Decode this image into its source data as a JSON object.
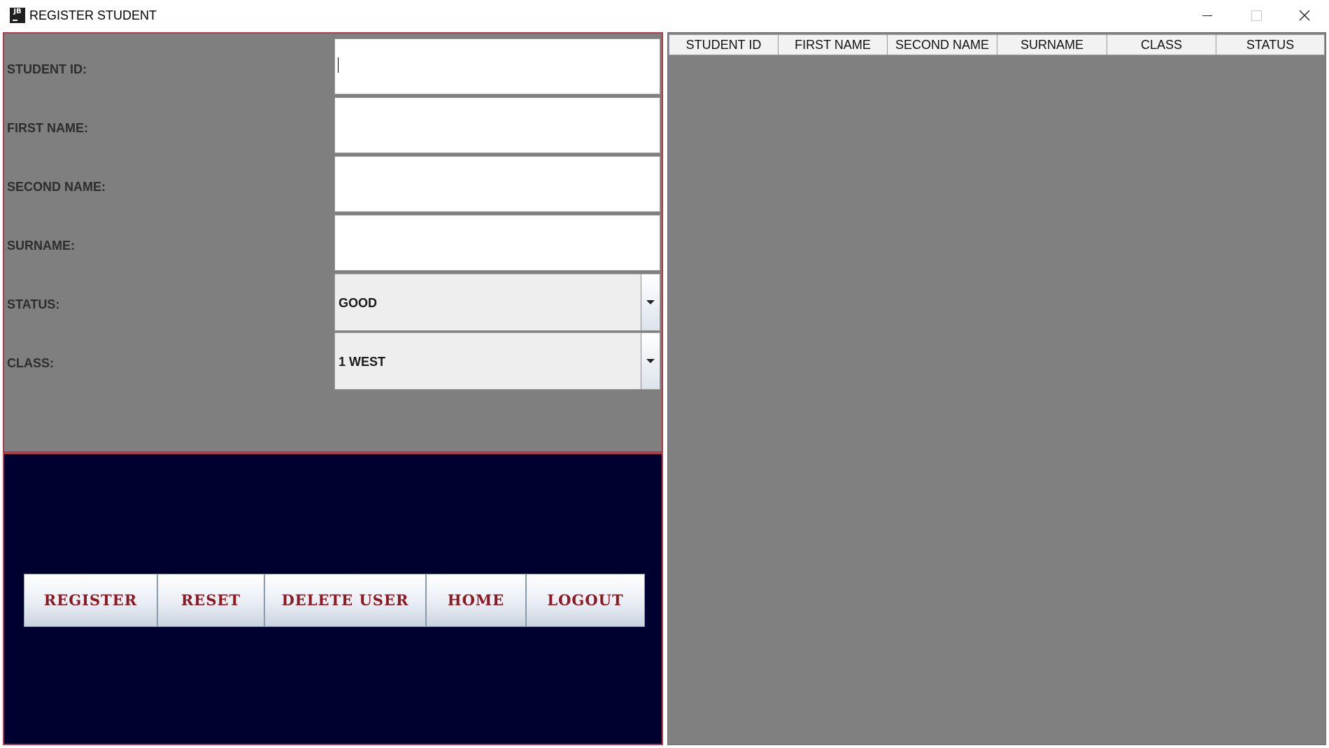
{
  "window": {
    "app_icon_text": "JB",
    "title": "REGISTER STUDENT",
    "controls": [
      "minimize",
      "maximize",
      "close"
    ]
  },
  "form": {
    "student_id": {
      "label": "STUDENT ID:",
      "value": ""
    },
    "first_name": {
      "label": "FIRST NAME:",
      "value": ""
    },
    "second_name": {
      "label": "SECOND NAME:",
      "value": ""
    },
    "surname": {
      "label": "SURNAME:",
      "value": ""
    },
    "status": {
      "label": "STATUS:",
      "selected": "GOOD"
    },
    "class": {
      "label": "CLASS:",
      "selected": "1 WEST"
    }
  },
  "buttons": {
    "register": "REGISTER",
    "reset": "RESET",
    "delete_user": "DELETE USER",
    "home": "HOME",
    "logout": "LOGOUT"
  },
  "table": {
    "columns": [
      "STUDENT ID",
      "FIRST NAME",
      "SECOND NAME",
      "SURNAME",
      "CLASS",
      "STATUS"
    ],
    "rows": []
  },
  "colors": {
    "panel_gray": "#7f7f7f",
    "button_panel_navy": "#000030",
    "panel_border_red": "#b43a4a",
    "button_text_red": "#8b1a24"
  }
}
